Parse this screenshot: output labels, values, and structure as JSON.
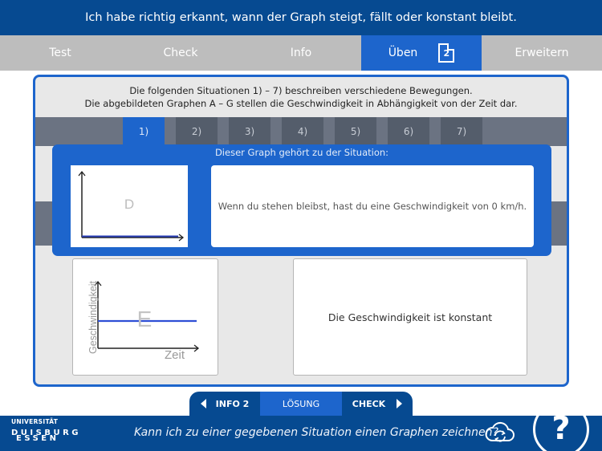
{
  "header": {
    "title": "Ich habe richtig erkannt, wann der Graph steigt, fällt oder konstant bleibt."
  },
  "tabs": [
    {
      "label": "Test",
      "active": false
    },
    {
      "label": "Check",
      "active": false
    },
    {
      "label": "Info",
      "active": false
    },
    {
      "label": "Üben",
      "active": true,
      "badge": "2",
      "badge_icon": "document-icon"
    },
    {
      "label": "Erweitern",
      "active": false
    }
  ],
  "intro": {
    "line1": "Die folgenden Situationen 1) – 7) beschreiben verschiedene Bewegungen.",
    "line2": "Die abgebildeten Graphen A – G stellen die Geschwindigkeit in Abhängigkeit von der Zeit dar."
  },
  "situation_tabs": [
    {
      "label": "1)",
      "active": true
    },
    {
      "label": "2)",
      "active": false
    },
    {
      "label": "3)",
      "active": false
    },
    {
      "label": "4)",
      "active": false
    },
    {
      "label": "5)",
      "active": false
    },
    {
      "label": "6)",
      "active": false
    },
    {
      "label": "7)",
      "active": false
    }
  ],
  "solution": {
    "title": "Dieser Graph gehört zu der Situation:",
    "graph_letter": "D",
    "text": "Wenn du stehen bleibst, hast du eine Geschwindigkeit von 0 km/h."
  },
  "card": {
    "graph_letter": "E",
    "y_label": "Geschwindigkeit",
    "x_label": "Zeit",
    "text": "Die Geschwindigkeit ist konstant"
  },
  "bottom_nav": {
    "prev": "INFO 2",
    "current": "LÖSUNG",
    "next": "CHECK"
  },
  "footer": {
    "logo_line1": "UNIVERSITÄT",
    "logo_line2": "DUISBURG",
    "logo_line3": "ESSEN",
    "question": "Kann ich zu einer gegebenen Situation einen Graphen zeichnen?",
    "help_symbol": "?"
  },
  "colors": {
    "header_blue": "#064a91",
    "accent_blue": "#1d65cc",
    "tab_gray": "#bdbdbd",
    "graph_line": "#2f4fd6"
  }
}
